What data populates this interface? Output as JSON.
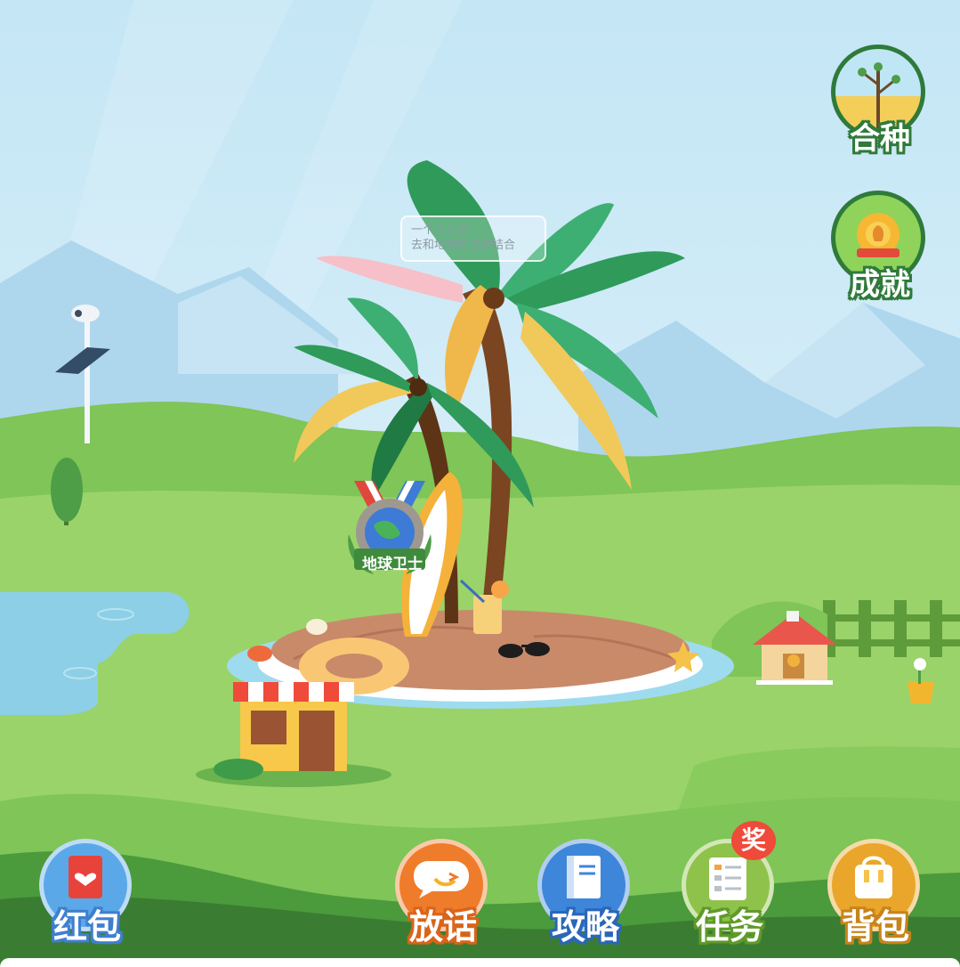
{
  "bubble": {
    "line1": "一个人走进",
    "line2": "去和地球的守护结合"
  },
  "medal": {
    "label": "地球卫士"
  },
  "side_buttons": {
    "plant": {
      "label": "合种",
      "icon": "sapling-icon"
    },
    "achievement": {
      "label": "成就",
      "icon": "trophy-sun-icon"
    }
  },
  "bottom_buttons": {
    "redpacket": {
      "label": "红包",
      "icon": "red-envelope-icon",
      "color": "#5aa8e8"
    },
    "chat": {
      "label": "放话",
      "icon": "chat-bubble-icon",
      "color": "#ef7c2a"
    },
    "guide": {
      "label": "攻略",
      "icon": "book-icon",
      "color": "#3d86d9"
    },
    "tasks": {
      "label": "任务",
      "icon": "checklist-icon",
      "color": "#8fc24a",
      "badge": "奖"
    },
    "backpack": {
      "label": "背包",
      "icon": "backpack-icon",
      "color": "#e9a62a"
    }
  },
  "colors": {
    "sky": "#bfe3f4",
    "grass": "#8fcf5f",
    "dark_green": "#2f7a3a"
  }
}
